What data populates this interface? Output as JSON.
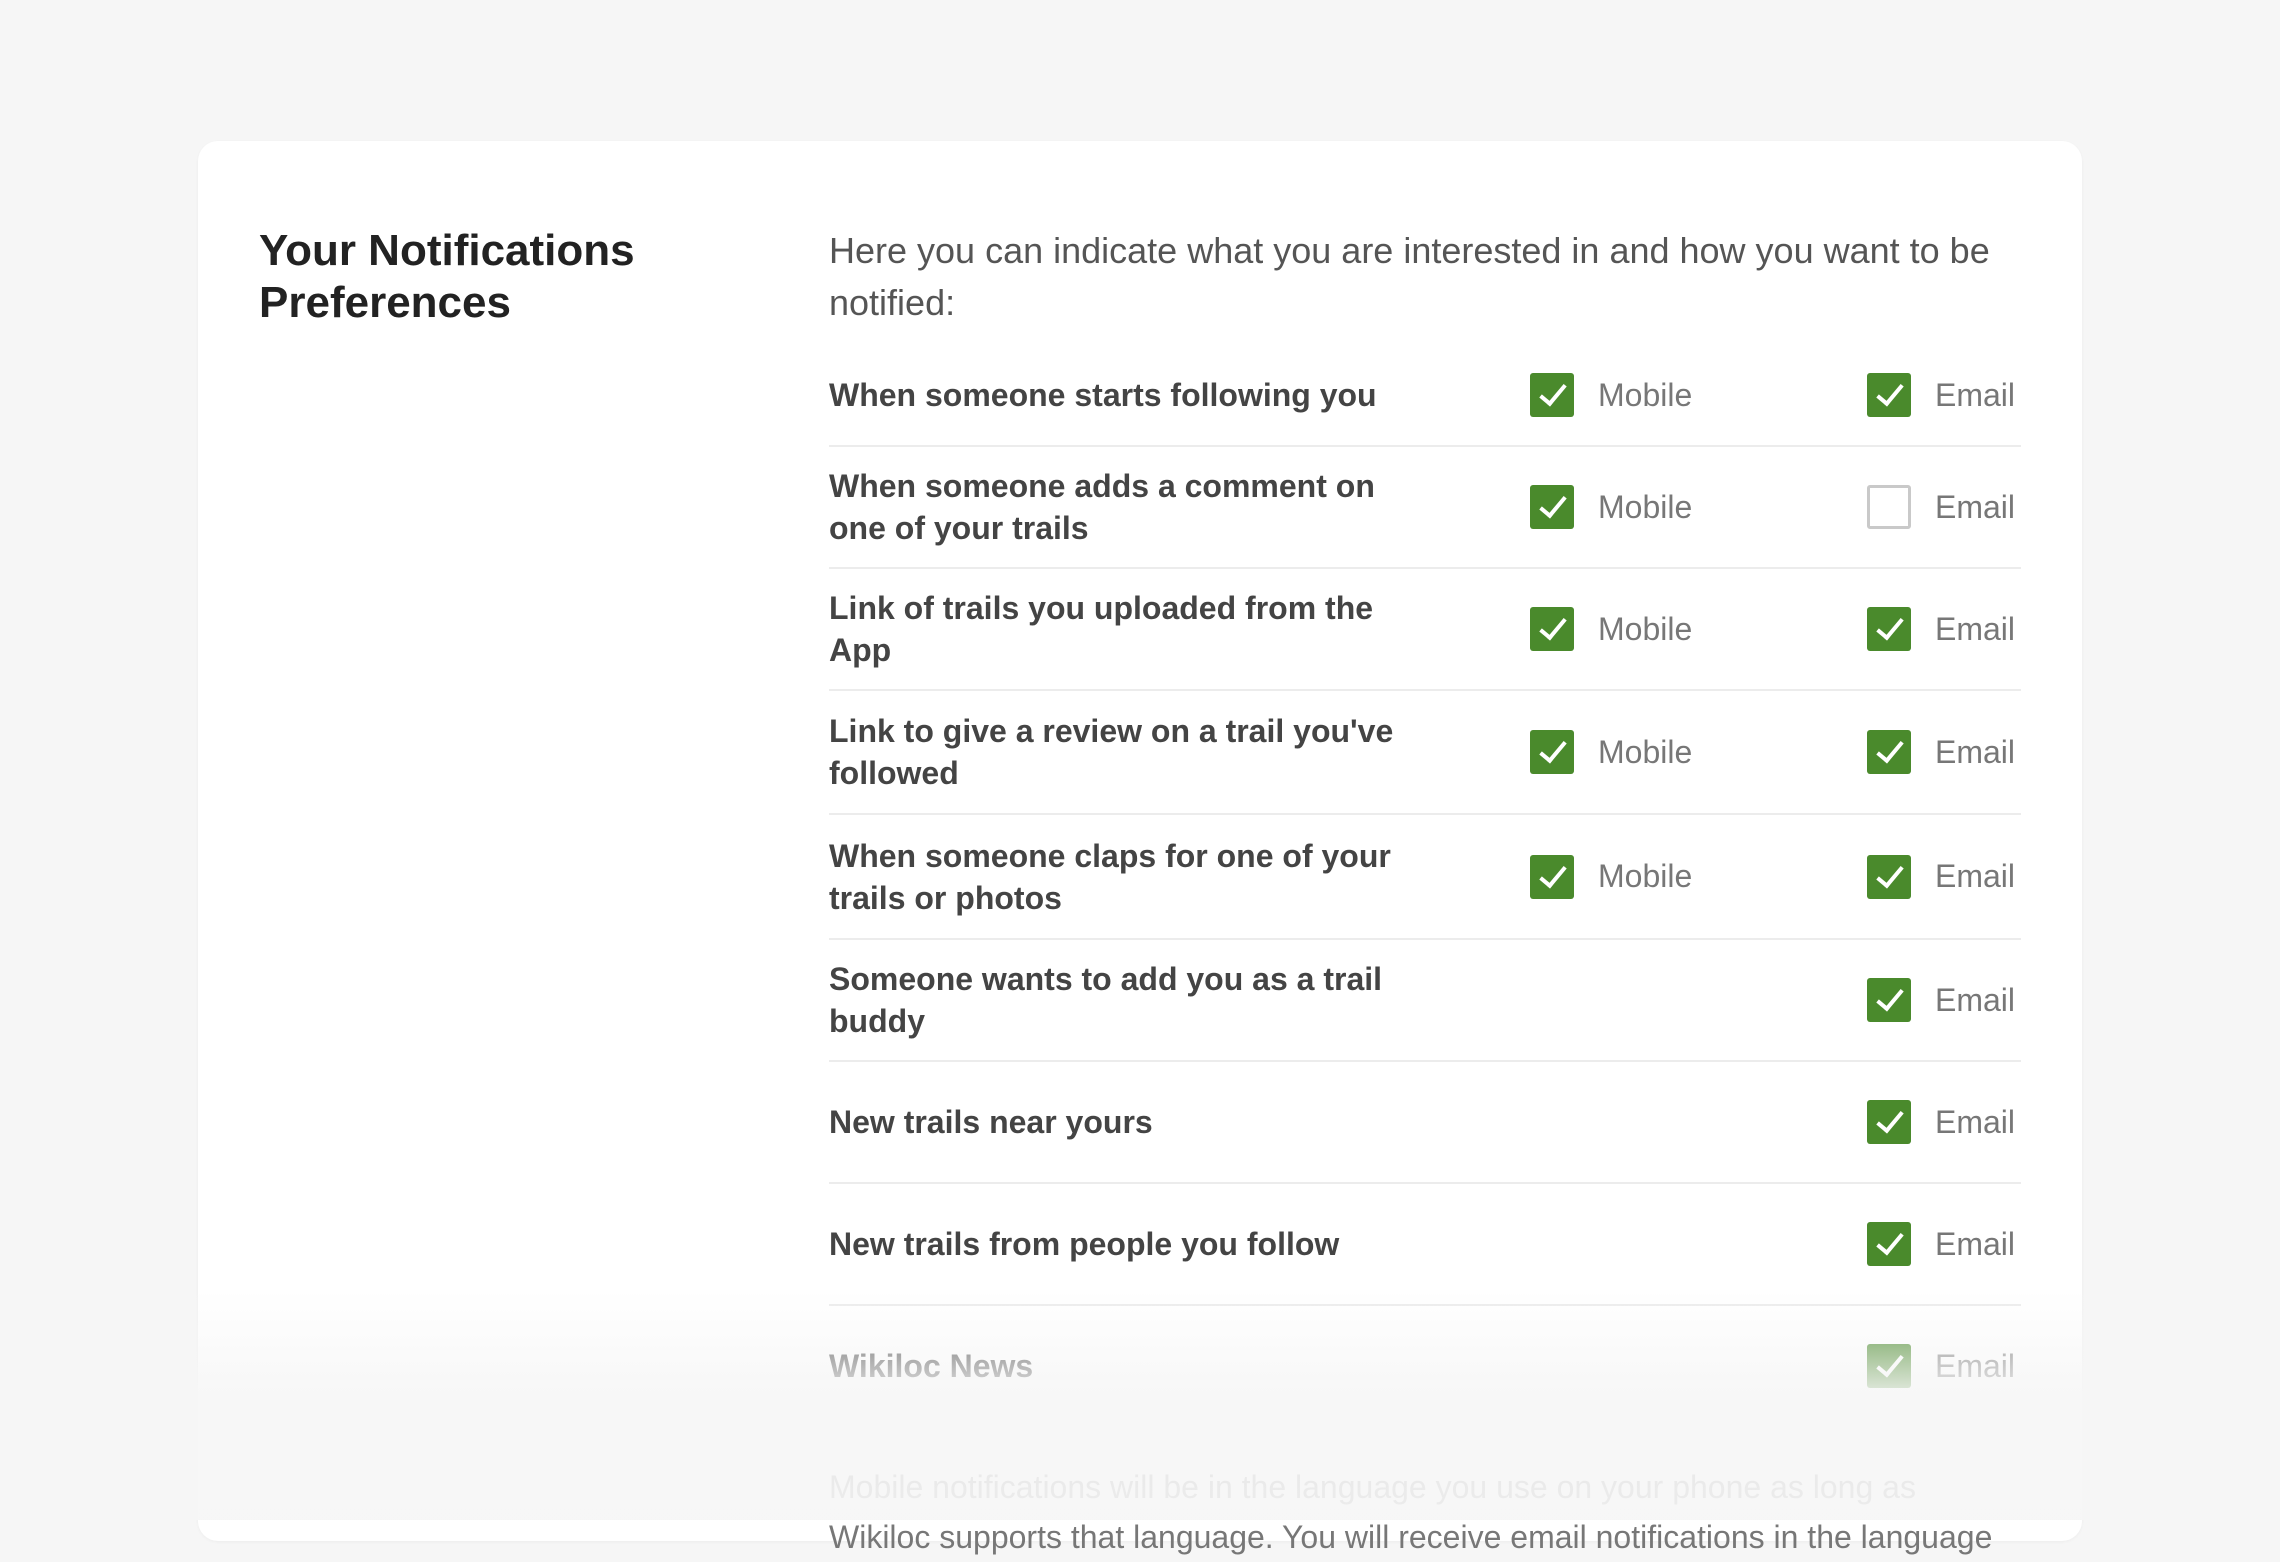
{
  "title": "Your Notifications Preferences",
  "intro": "Here you can indicate what you are interested in and how you want to be notified:",
  "options": {
    "mobile_label": "Mobile",
    "email_label": "Email"
  },
  "rows": [
    {
      "label": "When someone starts following you",
      "mobile": true,
      "email": true
    },
    {
      "label": "When someone adds a comment on one of your trails",
      "mobile": true,
      "email": false
    },
    {
      "label": "Link of trails you uploaded from the App",
      "mobile": true,
      "email": true
    },
    {
      "label": "Link to give a review on a trail you've followed",
      "mobile": true,
      "email": true
    },
    {
      "label": "When someone claps for one of your trails or photos",
      "mobile": true,
      "email": true
    },
    {
      "label": "Someone wants to add you as a trail buddy",
      "mobile": null,
      "email": true
    },
    {
      "label": "New trails near yours",
      "mobile": null,
      "email": true
    },
    {
      "label": "New trails from people you follow",
      "mobile": null,
      "email": true
    },
    {
      "label": "Wikiloc News",
      "mobile": null,
      "email": true
    }
  ],
  "footnote": "Mobile notifications will be in the language you use on your phone as long as Wikiloc supports that language. You will receive email notifications in the language",
  "colors": {
    "accent": "#4a8a2c",
    "background": "#f6f6f6",
    "card": "#ffffff"
  }
}
